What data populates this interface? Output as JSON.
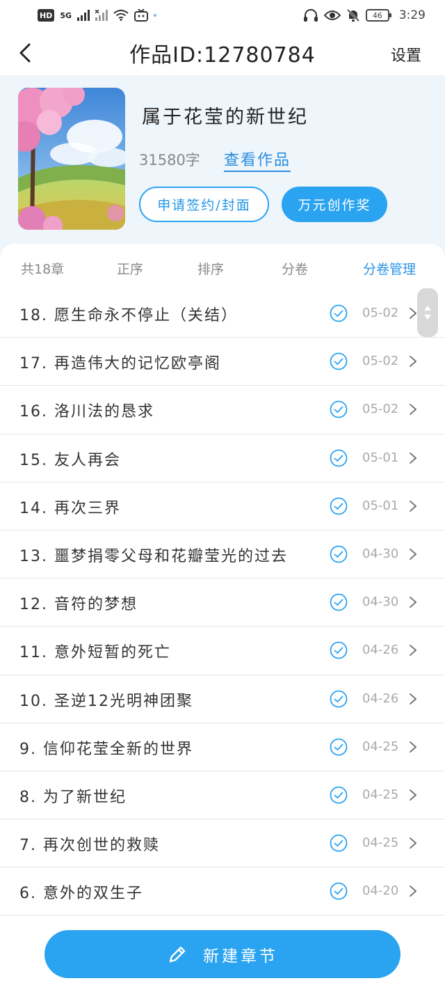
{
  "status_bar": {
    "hd_badge": "HD",
    "network": "5G",
    "battery": "46",
    "time": "3:29"
  },
  "nav": {
    "title": "作品ID:12780784",
    "settings_label": "设置"
  },
  "work": {
    "title": "属于花莹的新世纪",
    "word_count": "31580字",
    "view_link": "查看作品",
    "sign_button": "申请签约/封面",
    "award_button": "万元创作奖"
  },
  "toolbar": {
    "count": "共18章",
    "order": "正序",
    "sort": "排序",
    "volume": "分卷",
    "manage": "分卷管理"
  },
  "chapters": [
    {
      "title": "18. 愿生命永不停止（关结）",
      "date": "05-02"
    },
    {
      "title": "17. 再造伟大的记忆欧亭阁",
      "date": "05-02"
    },
    {
      "title": "16. 洛川法的恳求",
      "date": "05-02"
    },
    {
      "title": "15. 友人再会",
      "date": "05-01"
    },
    {
      "title": "14. 再次三界",
      "date": "05-01"
    },
    {
      "title": "13. 噩梦捐零父母和花瓣莹光的过去",
      "date": "04-30"
    },
    {
      "title": "12. 音符的梦想",
      "date": "04-30"
    },
    {
      "title": "11. 意外短暂的死亡",
      "date": "04-26"
    },
    {
      "title": "10. 圣逆12光明神团聚",
      "date": "04-26"
    },
    {
      "title": "9. 信仰花莹全新的世界",
      "date": "04-25"
    },
    {
      "title": "8. 为了新世纪",
      "date": "04-25"
    },
    {
      "title": "7. 再次创世的救赎",
      "date": "04-25"
    },
    {
      "title": "6. 意外的双生子",
      "date": "04-20"
    }
  ],
  "bottom": {
    "new_chapter_label": "新建章节"
  },
  "colors": {
    "accent": "#2aa3f0",
    "header_bg": "#eef5fb",
    "link": "#2a8fe0"
  }
}
